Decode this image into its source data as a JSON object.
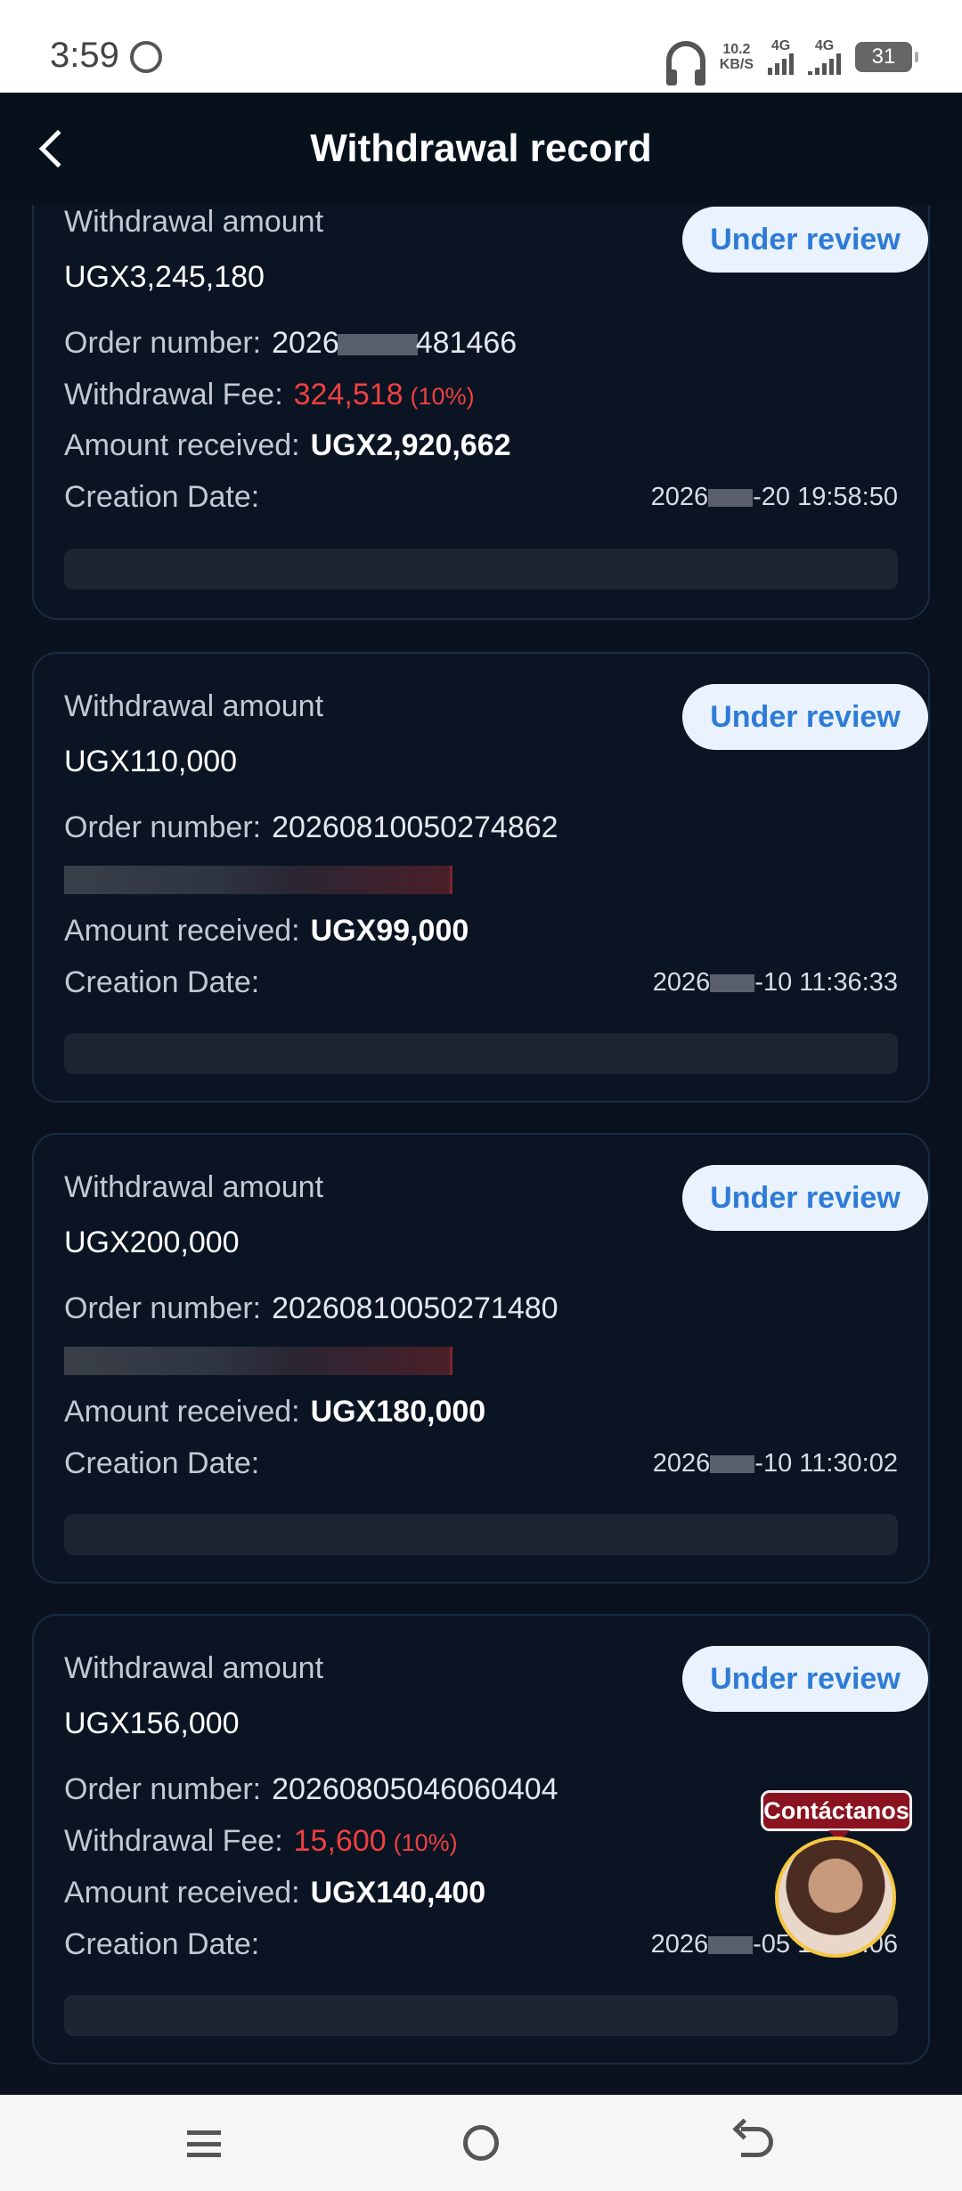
{
  "status_bar": {
    "time": "3:59",
    "net_speed_value": "10.2",
    "net_speed_unit": "KB/S",
    "signal_1_label": "4G",
    "signal_2_label": "4G",
    "battery": "31"
  },
  "header": {
    "title": "Withdrawal record"
  },
  "records": [
    {
      "amount_label": "Withdrawal amount",
      "amount": "UGX3,245,180",
      "status": "Under review",
      "order_label": "Order number:",
      "order_prefix": "2026",
      "order_suffix": "481466",
      "fee_label": "Withdrawal Fee:",
      "fee_value": "324,518",
      "fee_pct": "(10%)",
      "received_label": "Amount received:",
      "received_value": "UGX2,920,662",
      "date_label": "Creation Date:",
      "date_prefix": "2026",
      "date_suffix": "-20 19:58:50"
    },
    {
      "amount_label": "Withdrawal amount",
      "amount": "UGX110,000",
      "status": "Under review",
      "order_label": "Order number:",
      "order_number": "20260810050274862",
      "received_label": "Amount received:",
      "received_value": "UGX99,000",
      "date_label": "Creation Date:",
      "date_prefix": "2026",
      "date_suffix": "-10 11:36:33"
    },
    {
      "amount_label": "Withdrawal amount",
      "amount": "UGX200,000",
      "status": "Under review",
      "order_label": "Order number:",
      "order_number": "20260810050271480",
      "received_label": "Amount received:",
      "received_value": "UGX180,000",
      "date_label": "Creation Date:",
      "date_prefix": "2026",
      "date_suffix": "-10 11:30:02"
    },
    {
      "amount_label": "Withdrawal amount",
      "amount": "UGX156,000",
      "status": "Under review",
      "order_label": "Order number:",
      "order_number": "20260805046060404",
      "fee_label": "Withdrawal Fee:",
      "fee_value": "15,600",
      "fee_pct": "(10%)",
      "received_label": "Amount received:",
      "received_value": "UGX140,400",
      "date_label": "Creation Date:",
      "date_prefix": "2026",
      "date_suffix": "-05 14:12:06"
    }
  ],
  "contact": {
    "label": "Contáctanos"
  },
  "colors": {
    "accent": "#2e7bd6",
    "fee": "#ee4040",
    "background": "#0a1220"
  }
}
